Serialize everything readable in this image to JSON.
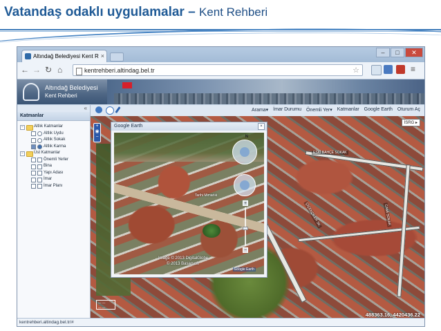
{
  "slide": {
    "title_bold": "Vatandaş odaklı uygulamalar –",
    "title_rest": "Kent Rehberi"
  },
  "browser": {
    "tab_title": "Altındağ Belediyesi Kent R",
    "url": "kentrehberi.altindag.bel.tr",
    "status_url": "kentrehberi.altindag.bel.tr/#"
  },
  "banner": {
    "line1": "Altındağ Belediyesi",
    "line2": "Kent Rehberi"
  },
  "menu": [
    {
      "label": "Arama▾"
    },
    {
      "label": "İmar Durumu"
    },
    {
      "label": "Önemli Yer▾"
    },
    {
      "label": "Katmanlar"
    },
    {
      "label": "Google Earth"
    },
    {
      "label": "Oturum Aç"
    }
  ],
  "sidebar": {
    "collapse_glyph": "«",
    "title": "Katmanlar",
    "tree": [
      {
        "level": 0,
        "expander": "−",
        "label": "Altlık Katmanlar",
        "type": "folder"
      },
      {
        "level": 1,
        "label": "Altlık Uydu",
        "type": "radio",
        "on": false
      },
      {
        "level": 1,
        "label": "Altlık Sokak",
        "type": "radio",
        "on": false
      },
      {
        "level": 1,
        "label": "Altlık Karma",
        "type": "radio",
        "on": true
      },
      {
        "level": 0,
        "expander": "−",
        "label": "Üst Katmanlar",
        "type": "folder"
      },
      {
        "level": 1,
        "label": "Önemli Yerler",
        "type": "check",
        "on": false
      },
      {
        "level": 1,
        "label": "Bina",
        "type": "check",
        "on": false
      },
      {
        "level": 1,
        "label": "Yapı Adası",
        "type": "check",
        "on": false
      },
      {
        "level": 1,
        "label": "İmar",
        "type": "check",
        "on": false
      },
      {
        "level": 1,
        "label": "İmar Planı",
        "type": "check",
        "on": false
      }
    ]
  },
  "map": {
    "basemap_button": "İSRG ▸",
    "coordinates": "488363.16, 4420436.22"
  },
  "google_earth": {
    "title": "Google Earth",
    "close_glyph": "×",
    "compass_label": "N",
    "zoom_in": "+",
    "zoom_out": "−",
    "place_label": "Tarihi Mimarlık",
    "credit_line1": "Image © 2013 DigitalGlobe",
    "credit_line2": "© 2013 Basarsoft",
    "corner_logo": "Google Earth",
    "zoom_level": 0.45
  },
  "colors": {
    "title_blue": "#1f5a96",
    "banner_blue": "#3b5575",
    "close_red": "#c94a3d"
  },
  "icons": {
    "back": "arrow-left-icon",
    "forward": "arrow-right-icon",
    "reload": "reload-icon",
    "home": "home-icon",
    "star": "star-icon"
  }
}
